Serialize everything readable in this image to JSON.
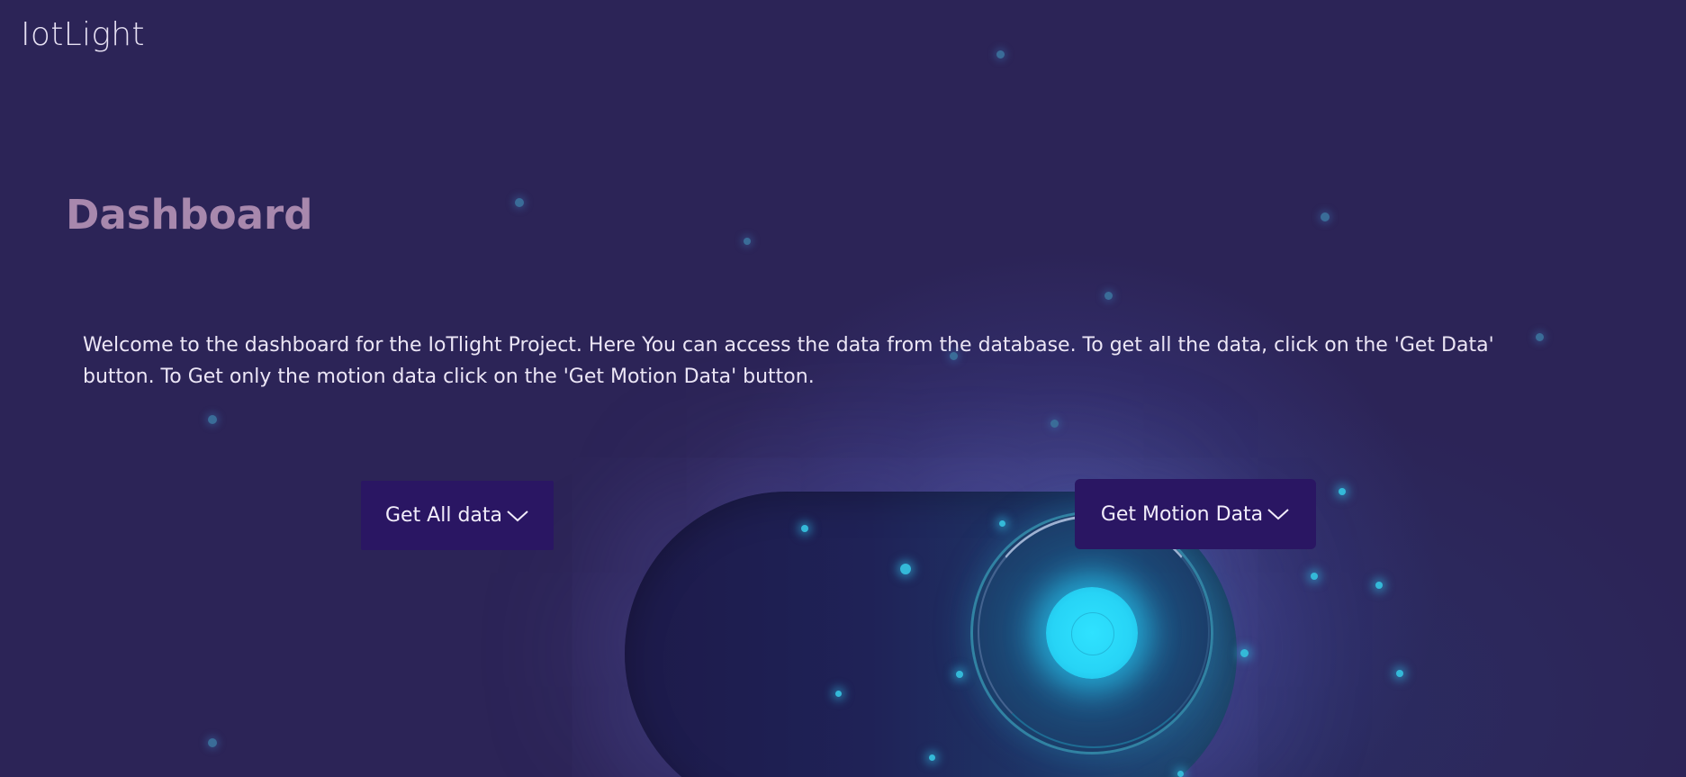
{
  "header": {
    "brand": "IotLight"
  },
  "main": {
    "title": "Dashboard",
    "welcome": "Welcome to the dashboard for the IoTlight Project. Here You can access the data from the database. To get all the data, click on the 'Get Data' button. To Get only the motion data click on the 'Get Motion Data' button."
  },
  "buttons": {
    "get_all": "Get All data",
    "get_motion": "Get Motion Data"
  },
  "icons": {
    "dropdown": "chevron-down-icon",
    "toggle": "toggle-switch-illustration"
  },
  "colors": {
    "background": "#2c2457",
    "button": "#2a1663",
    "title": "#a888ad",
    "glow": "#2fe2ff"
  }
}
